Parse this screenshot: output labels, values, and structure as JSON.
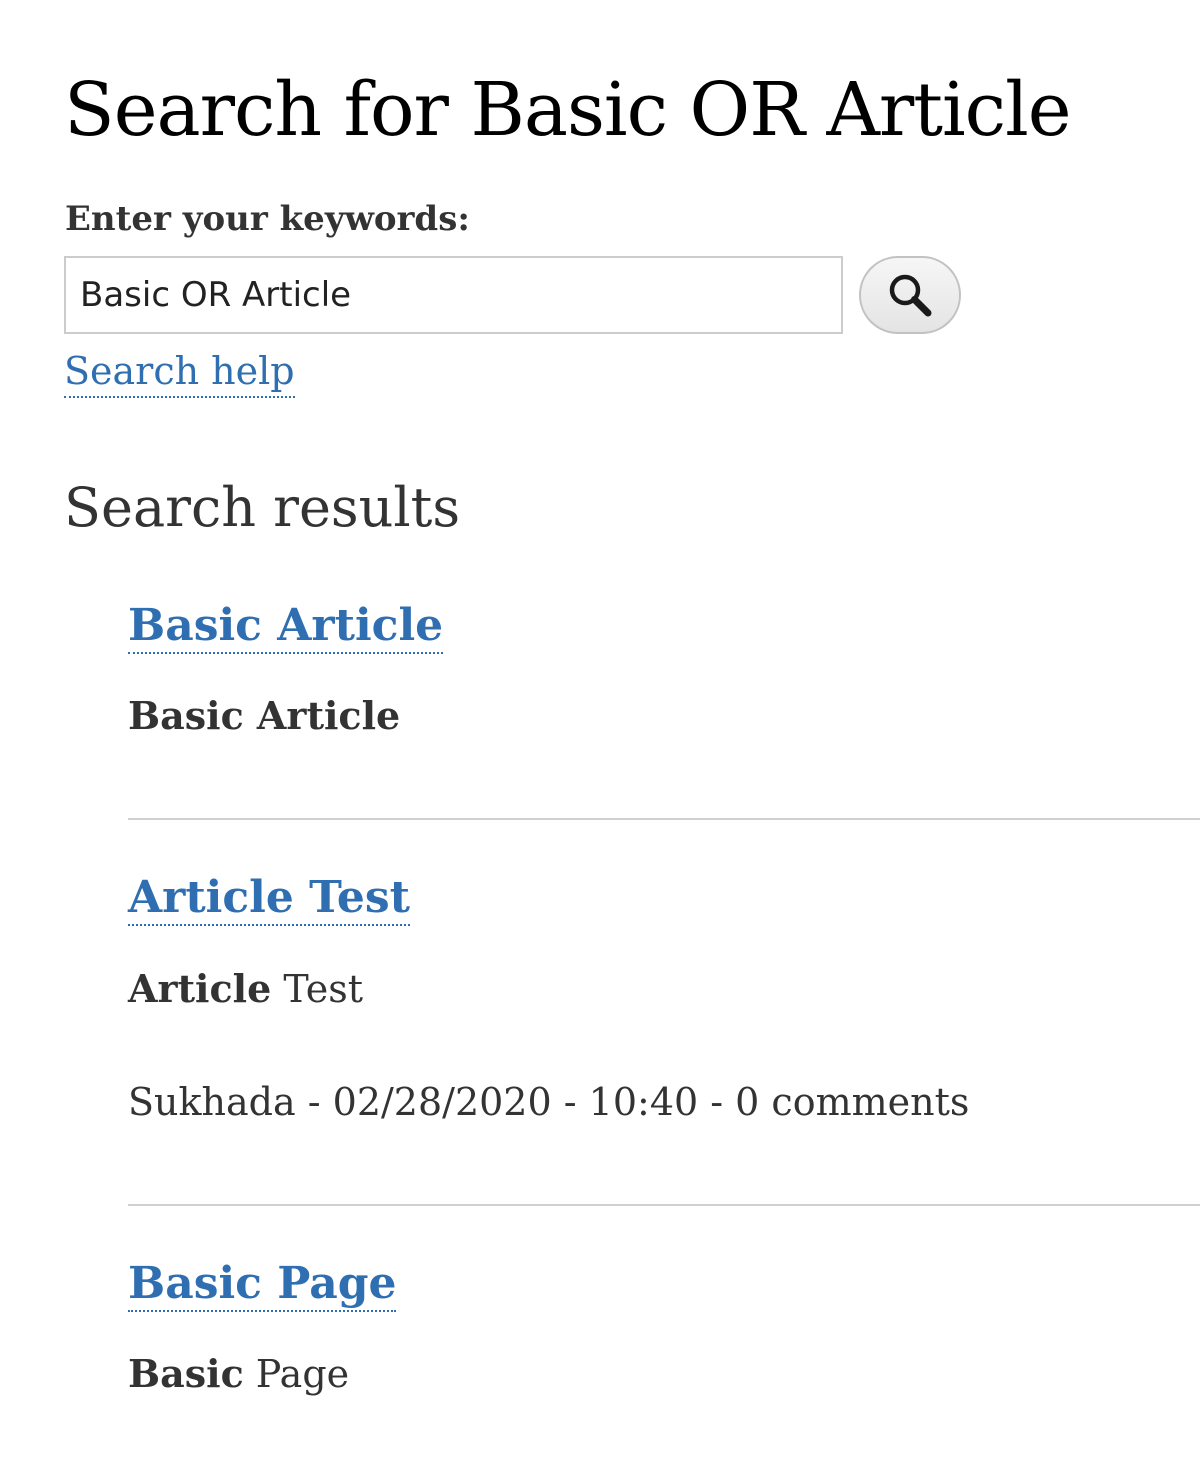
{
  "page": {
    "title": "Search for Basic OR Article"
  },
  "search_form": {
    "keywords_label": "Enter your keywords:",
    "input_value": "Basic OR Article",
    "help_link": "Search help"
  },
  "results": {
    "heading": "Search results",
    "items": [
      {
        "title": "Basic Article",
        "snippet_bold": "Basic Article",
        "snippet_rest": "",
        "meta": ""
      },
      {
        "title": "Article Test",
        "snippet_bold": "Article",
        "snippet_rest": " Test",
        "meta": "Sukhada - 02/28/2020 - 10:40 - 0 comments"
      },
      {
        "title": "Basic Page",
        "snippet_bold": "Basic",
        "snippet_rest": " Page",
        "meta": ""
      }
    ]
  },
  "colors": {
    "link": "#2f6fb1",
    "text": "#333333",
    "divider": "#d0d0d0"
  }
}
